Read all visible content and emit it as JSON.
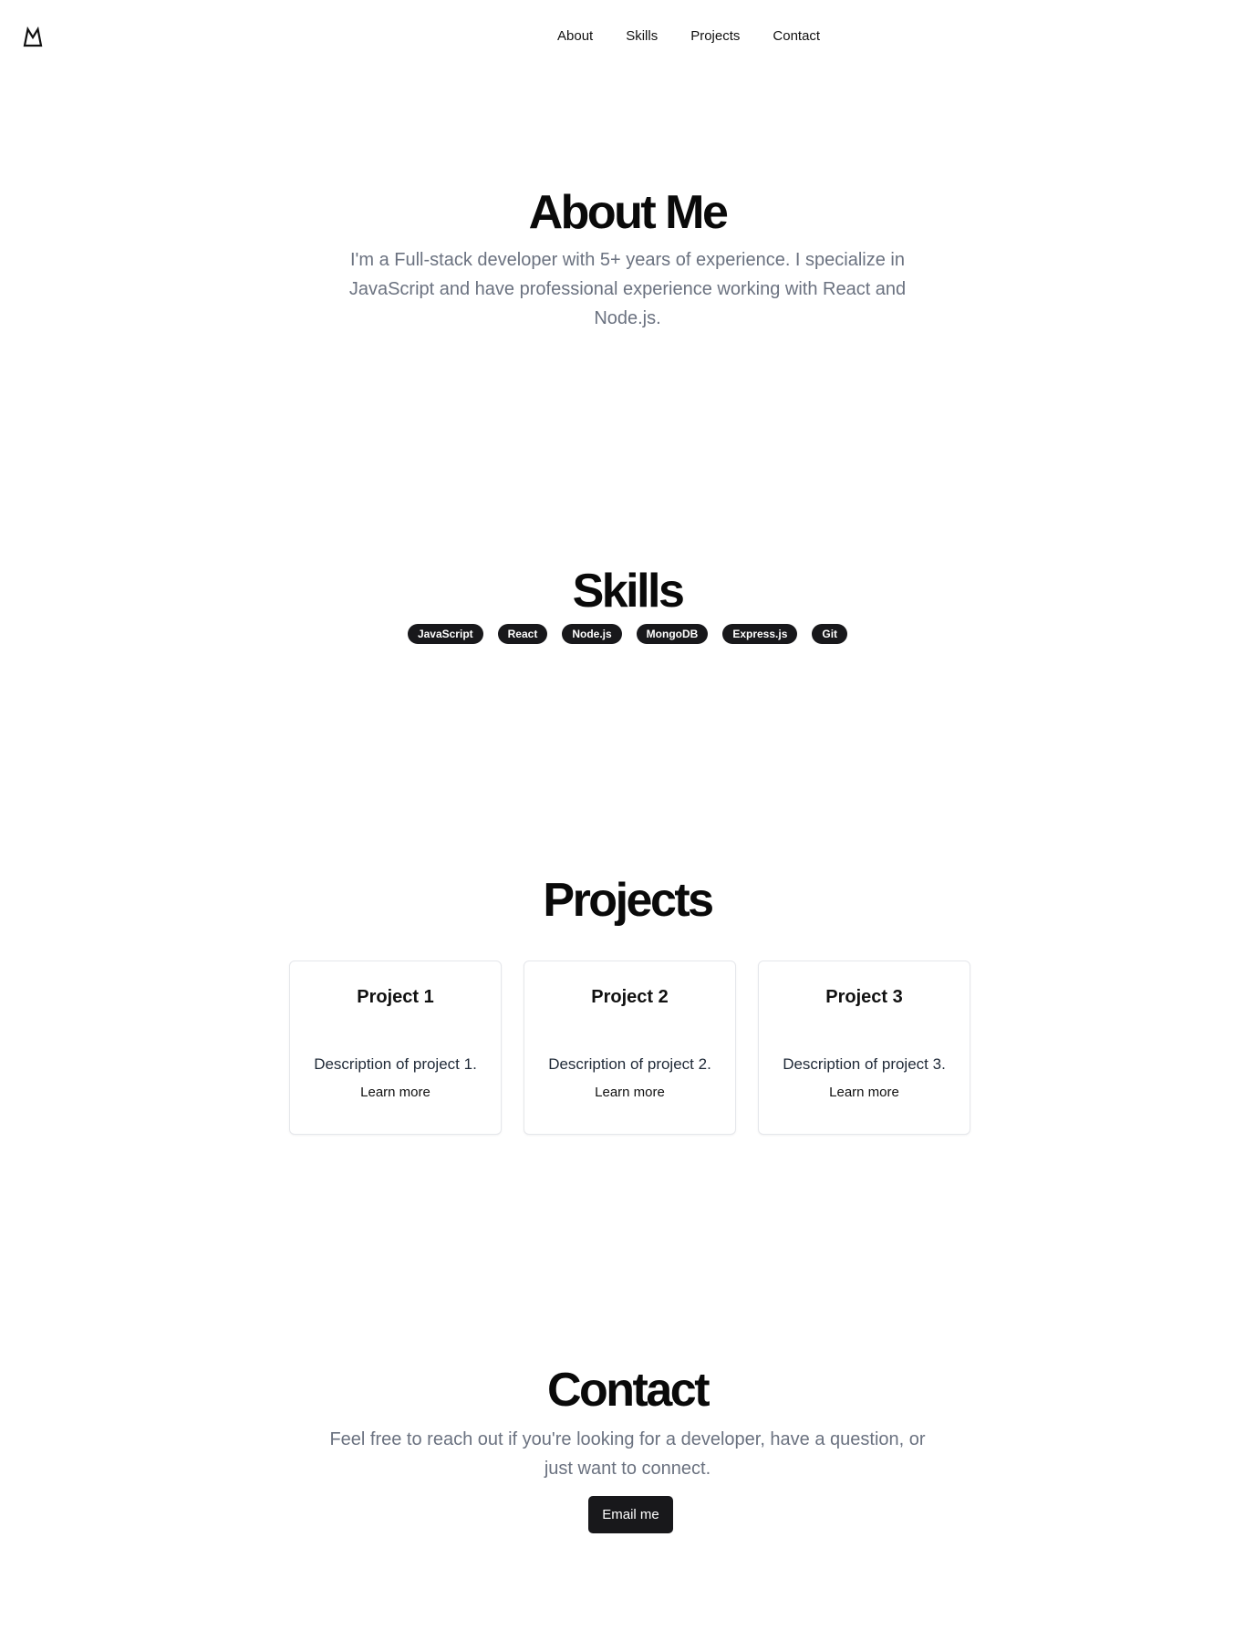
{
  "header": {
    "logo_icon": "mountain-icon",
    "nav": [
      "About",
      "Skills",
      "Projects",
      "Contact"
    ]
  },
  "about": {
    "title": "About Me",
    "text_lines": [
      "I'm a Full-stack developer with 5+ years of experience. I specialize in",
      "JavaScript and have professional experience working with React and",
      "Node.js."
    ]
  },
  "skills": {
    "title": "Skills",
    "items": [
      "JavaScript",
      "React",
      "Node.js",
      "MongoDB",
      "Express.js",
      "Git"
    ]
  },
  "projects": {
    "title": "Projects",
    "items": [
      {
        "name": "Project 1",
        "description": "Description of project 1.",
        "link": "Learn more"
      },
      {
        "name": "Project 2",
        "description": "Description of project 2.",
        "link": "Learn more"
      },
      {
        "name": "Project 3",
        "description": "Description of project 3.",
        "link": "Learn more"
      }
    ]
  },
  "contact": {
    "title": "Contact",
    "text_lines": [
      "Feel free to reach out if you're looking for a developer, have a question, or",
      "just want to connect."
    ],
    "button": "Email me"
  },
  "colors": {
    "accent_dark": "#18181b",
    "muted_text": "#6b7280",
    "card_border": "#e5e7eb"
  }
}
